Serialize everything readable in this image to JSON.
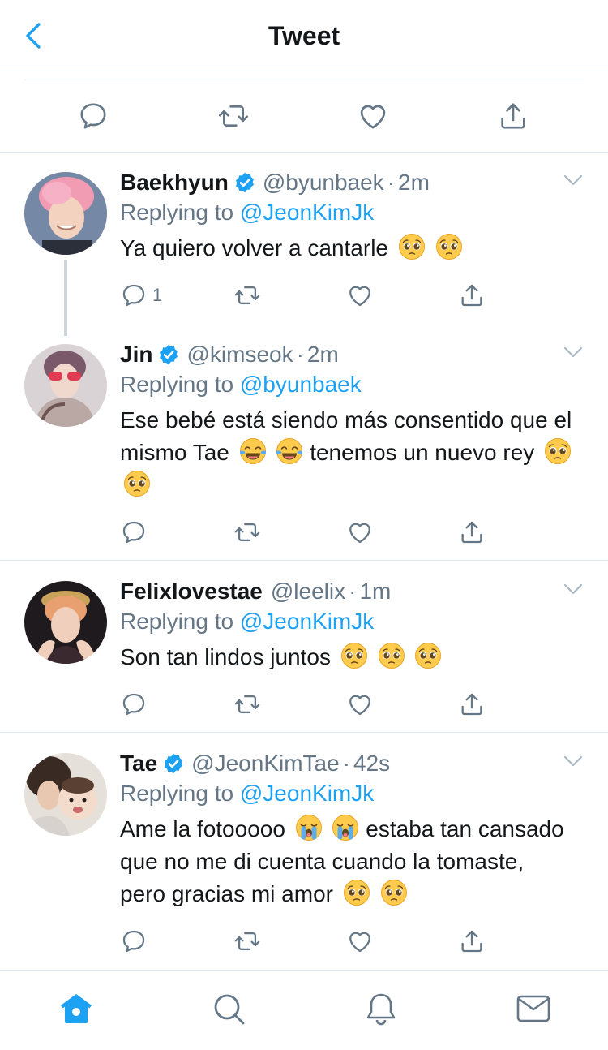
{
  "header": {
    "title": "Tweet"
  },
  "colors": {
    "accent": "#1da1f2",
    "icon_gray": "#657786",
    "text": "#14171a",
    "divider": "#e1e8ed"
  },
  "top_actions": [
    "reply-icon",
    "retweet-icon",
    "like-icon",
    "share-icon"
  ],
  "replies": [
    {
      "name": "Baekhyun",
      "verified": true,
      "handle": "@byunbaek",
      "sep": "·",
      "time": "2m",
      "replying_label": "Replying to ",
      "replying_to": "@JeonKimJk",
      "text": "Ya quiero volver a cantarle",
      "emojis": [
        "pleading-face",
        "pleading-face"
      ],
      "reply_count": "1"
    },
    {
      "name": "Jin",
      "verified": true,
      "handle": "@kimseok",
      "sep": "·",
      "time": "2m",
      "replying_label": "Replying to ",
      "replying_to": "@byunbaek",
      "text_parts": [
        "Ese bebé está siendo más consentido que el mismo Tae",
        "tenemos un nuevo rey"
      ],
      "emojis_1": [
        "tears-of-joy",
        "tears-of-joy"
      ],
      "emojis_2": [
        "pleading-face",
        "pleading-face"
      ]
    },
    {
      "name": "Felixlovestae",
      "verified": false,
      "handle": "@leelix",
      "sep": "·",
      "time": "1m",
      "replying_label": "Replying to ",
      "replying_to": "@JeonKimJk",
      "text": "Son tan lindos juntos",
      "emojis": [
        "pleading-face",
        "pleading-face",
        "pleading-face"
      ]
    },
    {
      "name": "Tae",
      "verified": true,
      "handle": "@JeonKimTae",
      "sep": "·",
      "time": "42s",
      "replying_label": "Replying to ",
      "replying_to": "@JeonKimJk",
      "text_parts": [
        "Ame la fotooooo",
        "estaba tan cansado que no me di cuenta cuando la tomaste, pero gracias mi amor"
      ],
      "emojis_1": [
        "loudly-crying-face",
        "loudly-crying-face"
      ],
      "emojis_2": [
        "pleading-face",
        "pleading-face"
      ]
    }
  ],
  "tabbar": [
    "home-icon",
    "search-icon",
    "notifications-icon",
    "messages-icon"
  ]
}
